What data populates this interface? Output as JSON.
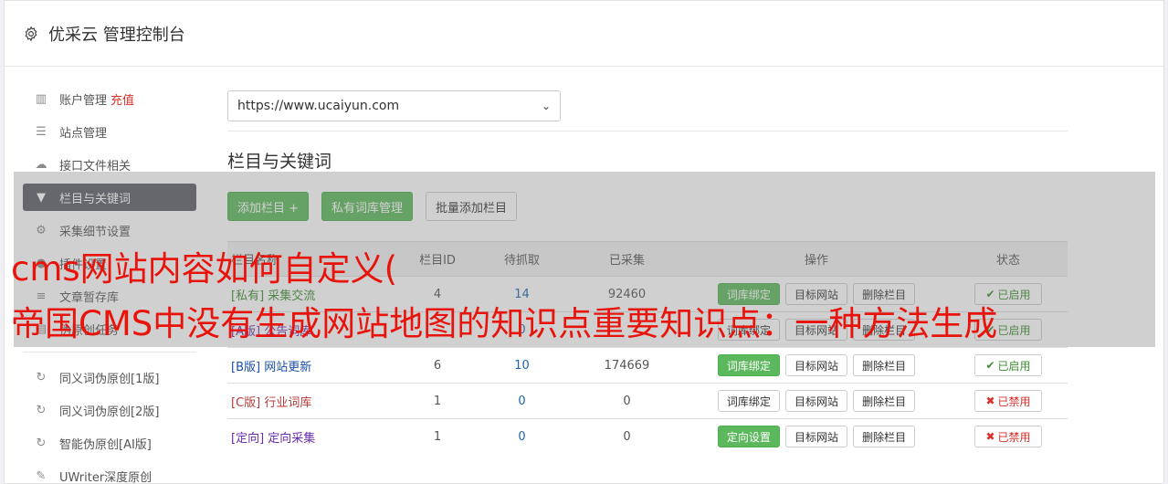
{
  "header": {
    "title": "优采云 管理控制台",
    "icon": "gear-icon"
  },
  "sidebar": {
    "items": [
      {
        "label": "账户管理",
        "extra": "充值",
        "icon": "bar-chart-icon",
        "glyph": "▥"
      },
      {
        "label": "站点管理",
        "icon": "server-icon",
        "glyph": "☰"
      },
      {
        "label": "接口文件相关",
        "icon": "cloud-upload-icon",
        "glyph": "☁"
      },
      {
        "label": "栏目与关键词",
        "icon": "filter-icon",
        "glyph": "▼",
        "active": true
      },
      {
        "label": "采集细节设置",
        "icon": "cogs-icon",
        "glyph": "⚙"
      },
      {
        "label": "插件设置",
        "icon": "plugin-icon",
        "glyph": "●"
      },
      {
        "label": "文章暂存库",
        "icon": "database-icon",
        "glyph": "≡"
      },
      {
        "label": "伪原创任务",
        "icon": "file-icon",
        "glyph": "▤"
      }
    ],
    "items2": [
      {
        "label": "同义词伪原创[1版]",
        "icon": "refresh-icon",
        "glyph": "↻"
      },
      {
        "label": "同义词伪原创[2版]",
        "icon": "refresh-icon",
        "glyph": "↻"
      },
      {
        "label": "智能伪原创[AI版]",
        "icon": "refresh-icon",
        "glyph": "↻"
      },
      {
        "label": "UWriter深度原创",
        "icon": "edit-icon",
        "glyph": "✎"
      }
    ]
  },
  "main": {
    "site_select": "https://www.ucaiyun.com",
    "section_title": "栏目与关键词",
    "buttons": {
      "add_column": "添加栏目 +",
      "private_lib": "私有词库管理",
      "batch_add": "批量添加栏目"
    },
    "table": {
      "headers": [
        "栏目名称",
        "栏目ID",
        "待抓取",
        "已采集",
        "操作",
        "状态"
      ],
      "rows": [
        {
          "tag": "[私有]",
          "name": "采集交流",
          "id": "4",
          "pending": "14",
          "collected": "92460",
          "op1": "词库绑定",
          "op2": "目标网站",
          "op3": "删除栏目",
          "status": "已启用",
          "status_on": true,
          "tagcolor": "green",
          "op1green": true
        },
        {
          "tag": "[A版]",
          "name": "公告词库",
          "id": "",
          "pending": "0",
          "collected": "",
          "op1": "词库绑定",
          "op2": "目标网站",
          "op3": "删除栏目",
          "status": "已启用",
          "status_on": true,
          "tagcolor": "purple",
          "op1green": false
        },
        {
          "tag": "[B版]",
          "name": "网站更新",
          "id": "6",
          "pending": "10",
          "collected": "174669",
          "op1": "词库绑定",
          "op2": "目标网站",
          "op3": "删除栏目",
          "status": "已启用",
          "status_on": true,
          "tagcolor": "blue",
          "op1green": true
        },
        {
          "tag": "[C版]",
          "name": "行业词库",
          "id": "1",
          "pending": "0",
          "collected": "0",
          "op1": "词库绑定",
          "op2": "目标网站",
          "op3": "删除栏目",
          "status": "已禁用",
          "status_on": false,
          "tagcolor": "red",
          "op1green": false
        },
        {
          "tag": "[定向]",
          "name": "定向采集",
          "id": "1",
          "pending": "0",
          "collected": "0",
          "op1": "定向设置",
          "op2": "目标网站",
          "op3": "删除栏目",
          "status": "已禁用",
          "status_on": false,
          "tagcolor": "purple",
          "op1green": true
        }
      ]
    }
  },
  "overlay": {
    "line1": "cms网站内容如何自定义(",
    "line2": "帝国CMS中没有生成网站地图的知识点重要知识点：一种方法生成"
  },
  "colors": {
    "accent_green": "#5cb85c",
    "active_nav": "#5b5f66",
    "overlay_red": "#e8140c"
  }
}
